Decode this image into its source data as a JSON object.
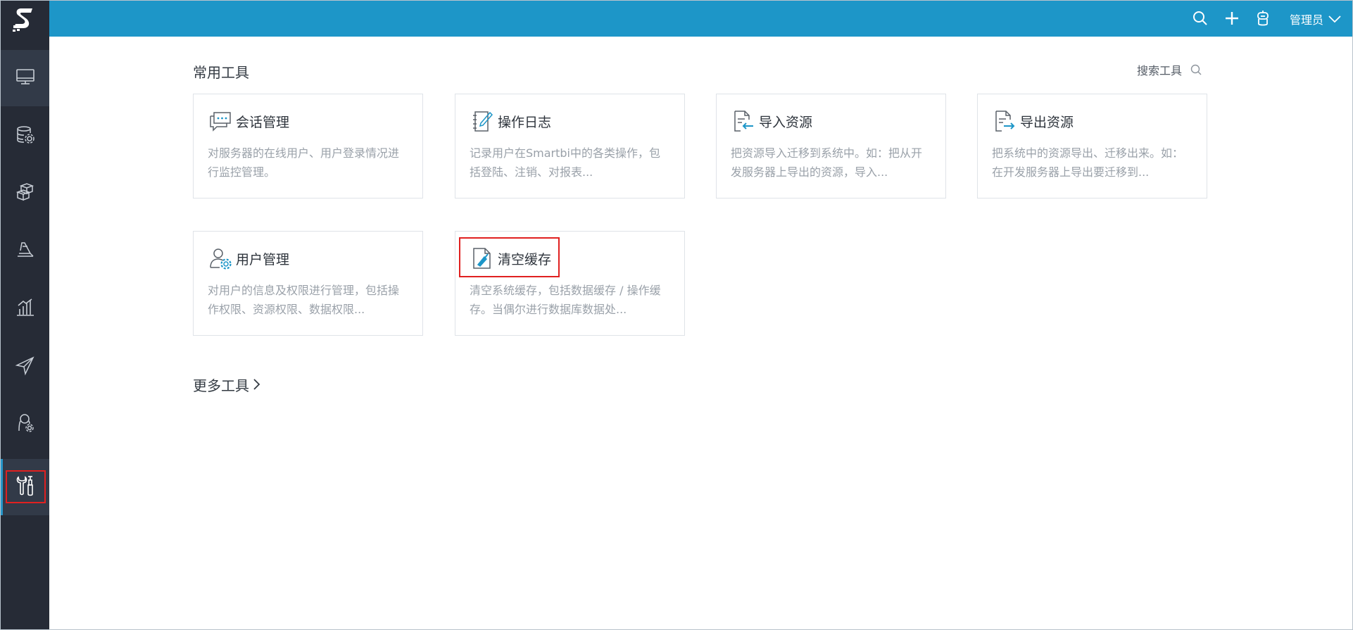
{
  "topbar": {
    "user_label": "管理员",
    "icons": [
      "search-icon",
      "plus-icon",
      "robot-icon",
      "chevron-down-icon"
    ]
  },
  "sidebar": {
    "items": [
      {
        "icon": "monitor-icon"
      },
      {
        "icon": "database-settings-icon"
      },
      {
        "icon": "cubes-icon"
      },
      {
        "icon": "document-stack-icon"
      },
      {
        "icon": "bar-chart-icon"
      },
      {
        "icon": "paper-plane-icon"
      },
      {
        "icon": "user-settings-icon"
      },
      {
        "icon": "tools-icon"
      }
    ]
  },
  "main": {
    "section_title": "常用工具",
    "search_label": "搜索工具",
    "more_label": "更多工具",
    "cards": [
      {
        "icon": "chat-icon",
        "title": "会话管理",
        "desc": [
          "对服务器的在线用户、用户登录情况进",
          "行监控管理。"
        ]
      },
      {
        "icon": "log-icon",
        "title": "操作日志",
        "desc": [
          "记录用户在Smartbi中的各类操作，包",
          "括登陆、注销、对报表..."
        ]
      },
      {
        "icon": "import-icon",
        "title": "导入资源",
        "desc": [
          "把资源导入迁移到系统中。如：把从开",
          "发服务器上导出的资源，导入..."
        ]
      },
      {
        "icon": "export-icon",
        "title": "导出资源",
        "desc": [
          "把系统中的资源导出、迁移出来。如：",
          "在开发服务器上导出要迁移到..."
        ]
      },
      {
        "icon": "user-gear-icon",
        "title": "用户管理",
        "desc": [
          "对用户的信息及权限进行管理，包括操",
          "作权限、资源权限、数据权限..."
        ]
      },
      {
        "icon": "broom-file-icon",
        "title": "清空缓存",
        "desc": [
          "清空系统缓存，包括数据缓存 / 操作缓",
          "存。当偶尔进行数据库数据处..."
        ]
      }
    ]
  },
  "colors": {
    "topbar": "#1d96c8",
    "sidebar": "#262b36",
    "accent": "#2796c9",
    "highlight": "#e02020"
  }
}
